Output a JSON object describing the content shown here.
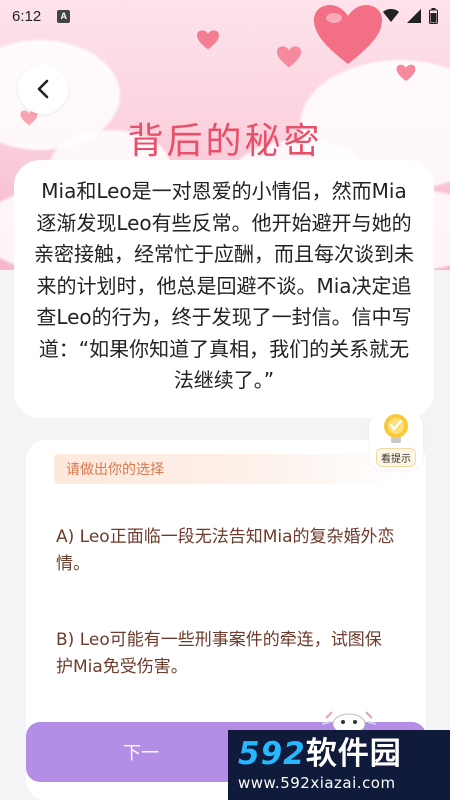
{
  "status_bar": {
    "time": "6:12",
    "indicator": "A"
  },
  "header": {
    "back_icon": "chevron-left-icon",
    "title": "背后的秘密"
  },
  "story": {
    "text": "Mia和Leo是一对恩爱的小情侣，然而Mia逐渐发现Leo有些反常。他开始避开与她的亲密接触，经常忙于应酬，而且每次谈到未来的计划时，他总是回避不谈。Mia决定追查Leo的行为，终于发现了一封信。信中写道：“如果你知道了真相，我们的关系就无法继续了。”"
  },
  "hint": {
    "icon": "lightbulb-icon",
    "label": "看提示"
  },
  "choices": {
    "prompt": "请做出你的选择",
    "options": [
      {
        "text": "A) Leo正面临一段无法告知Mia的复杂婚外恋情。"
      },
      {
        "text": "B) Leo可能有一些刑事案件的牵连，试图保护Mia免受伤害。"
      }
    ]
  },
  "next_button": {
    "label": "下一"
  },
  "watermark": {
    "brand_num": "592",
    "brand_cn": "软件园",
    "url": "www.592xiazai.com"
  },
  "colors": {
    "title": "#e8506a",
    "button": "#b48de6",
    "option_text": "#6e3b2c",
    "prompt_text": "#d77a4c"
  }
}
